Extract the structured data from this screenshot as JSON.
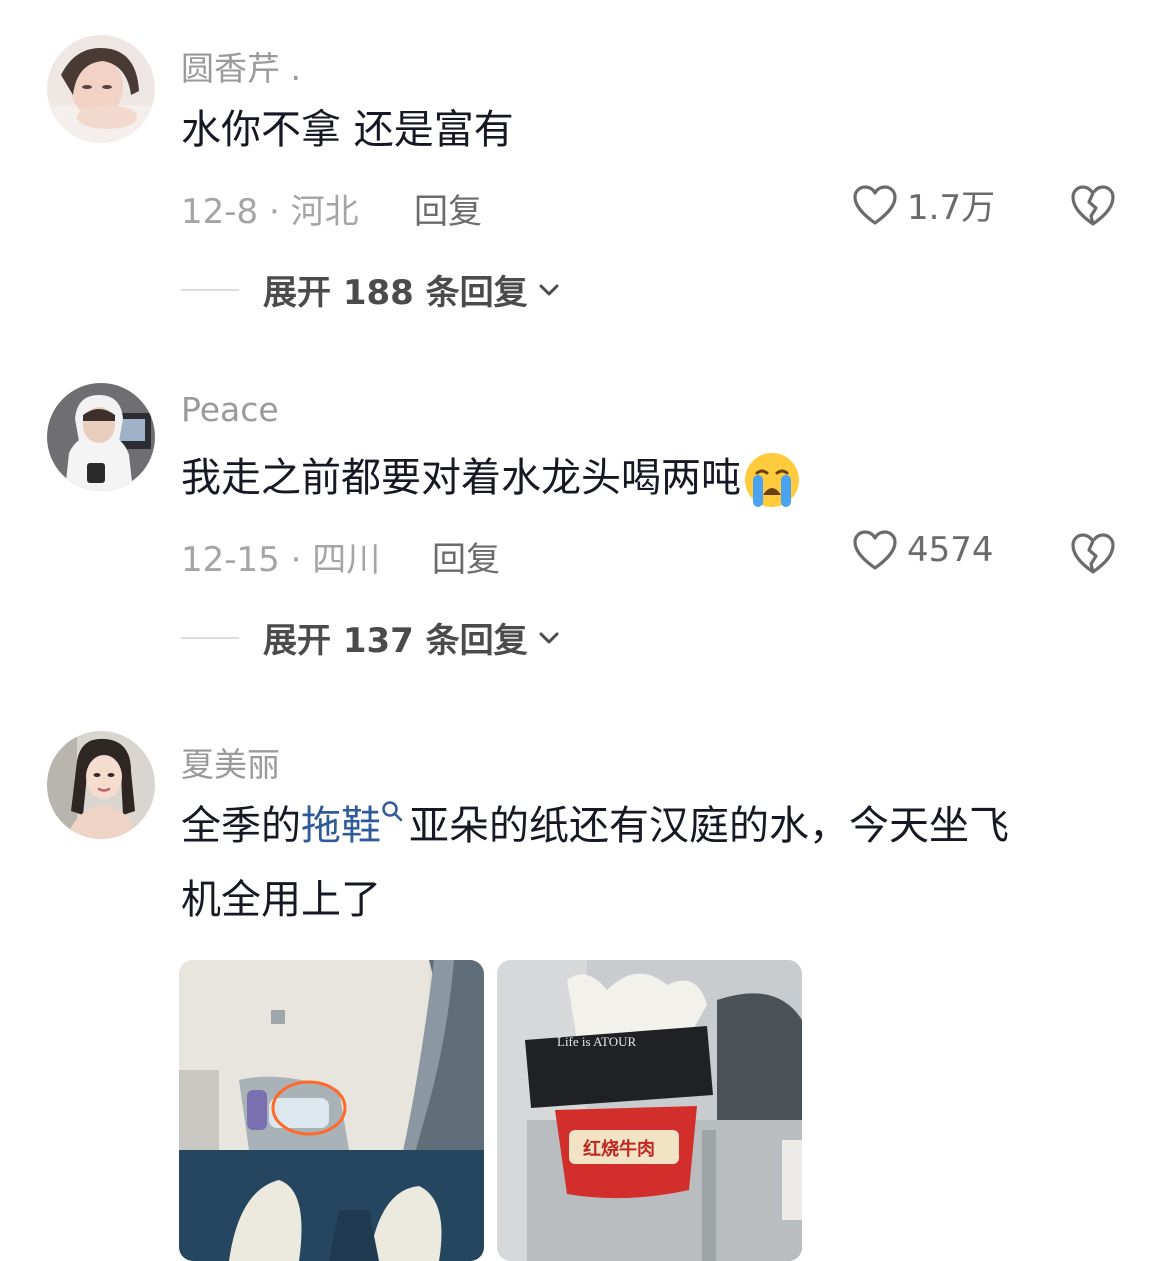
{
  "comments": [
    {
      "username": "圆香芹 .",
      "text": "水你不拿 还是富有",
      "date_location": "12-8 · 河北",
      "reply_label": "回复",
      "likes": "1.7万",
      "expand_label": "展开 188 条回复"
    },
    {
      "username": "Peace",
      "text": "我走之前都要对着水龙头喝两吨",
      "emoji": "loudly-crying-face",
      "date_location": "12-15 · 四川",
      "reply_label": "回复",
      "likes": "4574",
      "expand_label": "展开 137 条回复"
    },
    {
      "username": "夏美丽",
      "text_before": "全季的",
      "keyword": "拖鞋",
      "text_after": "亚朵的纸还有汉庭的水，今天坐飞",
      "text_line2": "机全用上了",
      "photos": [
        {
          "name": "airplane-seat-pocket-photo"
        },
        {
          "name": "tissue-and-noodle-photo",
          "tissue_brand": "Life is ATOUR",
          "noodle_label": "红烧牛肉"
        }
      ]
    }
  ],
  "colors": {
    "text": "#161823",
    "muted": "#9a9a9a",
    "link": "#2f5b9a",
    "circle_highlight": "#ff6a2a"
  }
}
